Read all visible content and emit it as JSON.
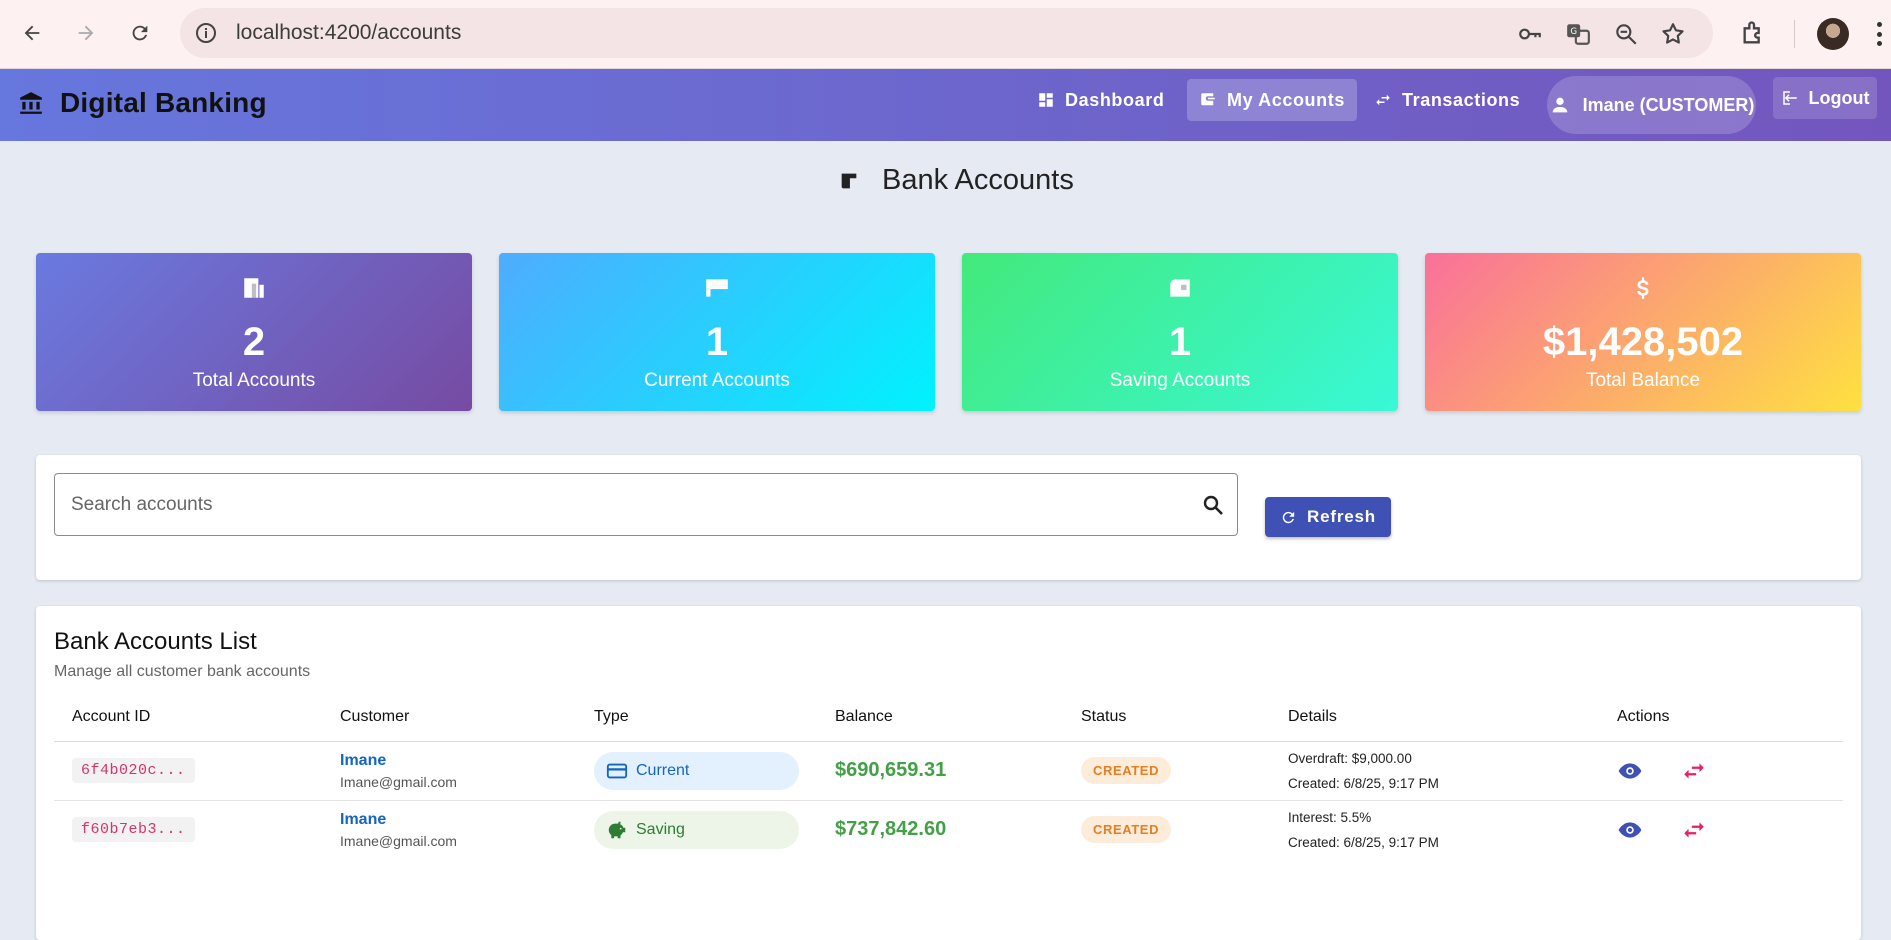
{
  "browser": {
    "url": "localhost:4200/accounts"
  },
  "app": {
    "title": "Digital Banking",
    "nav": [
      {
        "label": "Dashboard",
        "icon": "dashboard-icon"
      },
      {
        "label": "My Accounts",
        "icon": "wallet-icon",
        "active": true
      },
      {
        "label": "Transactions",
        "icon": "swap-icon"
      }
    ],
    "user": "Imane (CUSTOMER)",
    "logout": "Logout"
  },
  "page": {
    "title": "Bank Accounts"
  },
  "stats": [
    {
      "value": "2",
      "label": "Total Accounts",
      "icon": "bank-icon",
      "gradient": [
        "#6a7ae0",
        "#764ba2"
      ]
    },
    {
      "value": "1",
      "label": "Current Accounts",
      "icon": "card-icon",
      "gradient": [
        "#4facfe",
        "#00f2fe"
      ]
    },
    {
      "value": "1",
      "label": "Saving Accounts",
      "icon": "piggy-bank-icon",
      "gradient": [
        "#43e97b",
        "#38f9d7"
      ]
    },
    {
      "value": "$1,428,502",
      "label": "Total Balance",
      "icon": "dollar-icon",
      "gradient": [
        "#fa709a",
        "#fee140"
      ]
    }
  ],
  "search": {
    "placeholder": "Search accounts",
    "refresh_label": "Refresh"
  },
  "list": {
    "title": "Bank Accounts List",
    "subtitle": "Manage all customer bank accounts",
    "columns": [
      "Account ID",
      "Customer",
      "Type",
      "Balance",
      "Status",
      "Details",
      "Actions"
    ],
    "rows": [
      {
        "id": "6f4b020c...",
        "customer": "Imane",
        "email": "Imane@gmail.com",
        "type": "Current",
        "balance": "$690,659.31",
        "status": "CREATED",
        "detail1": "Overdraft: $9,000.00",
        "detail2": "Created: 6/8/25, 9:17 PM"
      },
      {
        "id": "f60b7eb3...",
        "customer": "Imane",
        "email": "Imane@gmail.com",
        "type": "Saving",
        "balance": "$737,842.60",
        "status": "CREATED",
        "detail1": "Interest: 5.5%",
        "detail2": "Created: 6/8/25, 9:17 PM"
      }
    ]
  },
  "colors": {
    "primary": "#3f51b5",
    "balance_green": "#43a047",
    "status_orange": "#e67e22"
  }
}
